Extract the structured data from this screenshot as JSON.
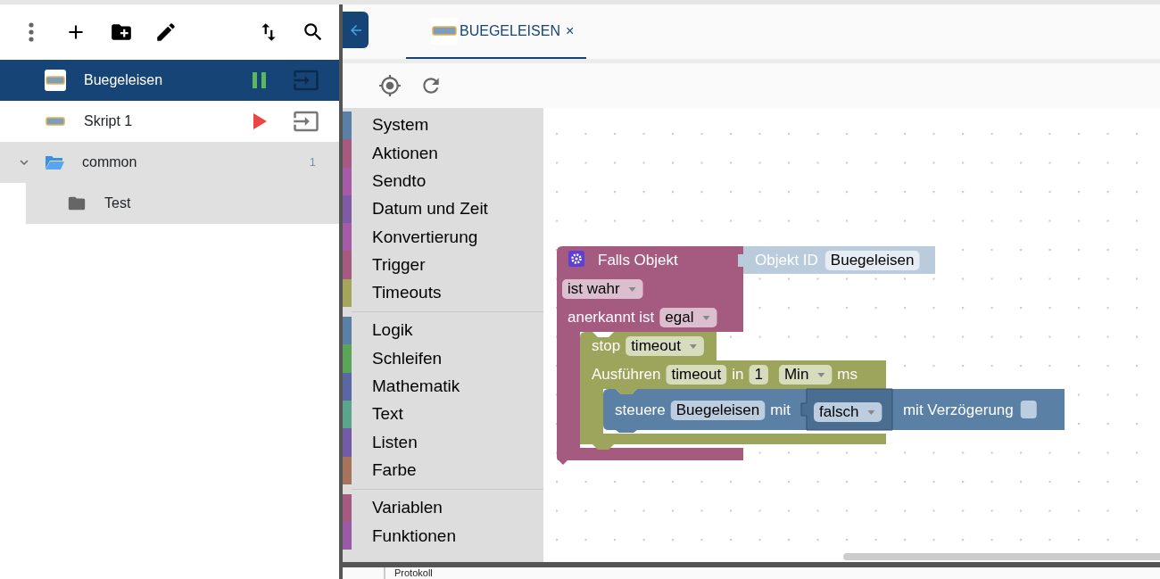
{
  "scripts": [
    {
      "name": "Buegeleisen",
      "selected": true,
      "running": true
    },
    {
      "name": "Skript 1",
      "selected": false,
      "running": false
    }
  ],
  "folders": [
    {
      "name": "common",
      "expanded": true,
      "count": "1",
      "children": [
        {
          "name": "Test"
        }
      ]
    }
  ],
  "tabs": [
    {
      "label": "BUEGELEISEN",
      "close": "×",
      "selected": true
    }
  ],
  "toolbox": {
    "groups": [
      {
        "items": [
          {
            "label": "System",
            "color": "#5b80a5"
          },
          {
            "label": "Aktionen",
            "color": "#a55b80"
          },
          {
            "label": "Sendto",
            "color": "#a55ba5"
          },
          {
            "label": "Datum und Zeit",
            "color": "#805ba5"
          },
          {
            "label": "Konvertierung",
            "color": "#a55ba5"
          },
          {
            "label": "Trigger",
            "color": "#a55b80"
          },
          {
            "label": "Timeouts",
            "color": "#a5a55b"
          }
        ]
      },
      {
        "items": [
          {
            "label": "Logik",
            "color": "#5b80a5"
          },
          {
            "label": "Schleifen",
            "color": "#5ba55b"
          },
          {
            "label": "Mathematik",
            "color": "#5b67a5"
          },
          {
            "label": "Text",
            "color": "#5ba58c"
          },
          {
            "label": "Listen",
            "color": "#745ba5"
          },
          {
            "label": "Farbe",
            "color": "#a5745b"
          }
        ]
      },
      {
        "items": [
          {
            "label": "Variablen",
            "color": "#a55b80"
          },
          {
            "label": "Funktionen",
            "color": "#995ba5"
          }
        ]
      }
    ]
  },
  "workspace": {
    "blocks": [
      {
        "kind": "trigger",
        "title": "Falls Objekt",
        "object": {
          "label": "Objekt ID",
          "value": "Buegeleisen"
        },
        "condition": "ist wahr",
        "ack_label": "anerkannt ist",
        "ack_value": "egal",
        "statements": [
          {
            "kind": "stop",
            "label": "stop",
            "value": "timeout"
          },
          {
            "kind": "timeout",
            "label": "Ausführen",
            "name": "timeout",
            "in_label": "in",
            "amount": "1",
            "unit": "Min",
            "unit_suffix": "ms",
            "statements": [
              {
                "kind": "control",
                "label": "steuere",
                "target": "Buegeleisen",
                "with_label": "mit",
                "value": "falsch",
                "delay_label": "mit Verzögerung",
                "delay": false
              }
            ]
          }
        ]
      }
    ]
  },
  "log": {
    "title": "Protokoll"
  }
}
